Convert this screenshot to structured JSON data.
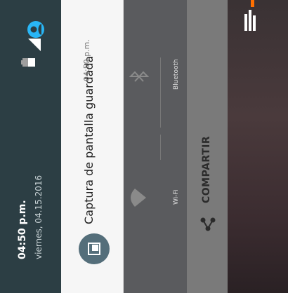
{
  "status_bar": {
    "time": "04:50 p.m.",
    "date": "viernes, 04.15.2016"
  },
  "notification": {
    "title": "Captura de pantalla guardada",
    "time": "04:50 p.m."
  },
  "quick_settings": {
    "wifi_label": "Wi-Fi",
    "bluetooth_label": "Bluetooth"
  },
  "action": {
    "share_label": "COMPARTIR"
  },
  "colors": {
    "header_bg": "#2c3e44",
    "notification_bg": "#f6f6f6",
    "quick_settings_bg": "#5a5b5e",
    "action_bar_bg": "#7a7a7a",
    "accent_blue": "#29b6f6",
    "accent_orange": "#ff6f00"
  },
  "icons": [
    "avatar-icon",
    "battery-icon",
    "signal-icon",
    "image-icon",
    "wifi-icon",
    "bluetooth-icon",
    "share-icon",
    "bar-chart-icon"
  ]
}
